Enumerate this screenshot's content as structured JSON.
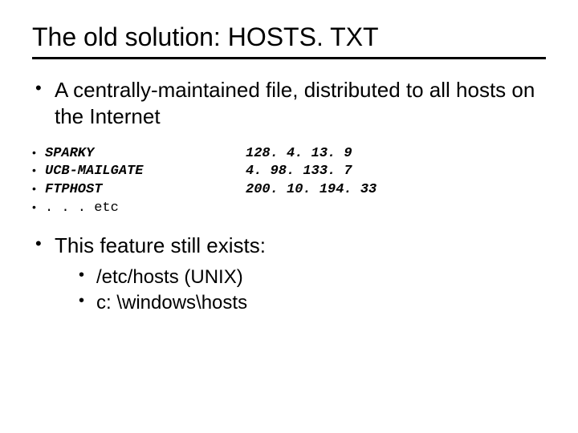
{
  "title": "The old solution: HOSTS. TXT",
  "bullet1": "A centrally-maintained file, distributed to all hosts on the Internet",
  "hosts": [
    {
      "name": "SPARKY",
      "ip": "128. 4. 13. 9"
    },
    {
      "name": "UCB-MAILGATE",
      "ip": "4. 98. 133. 7"
    },
    {
      "name": "FTPHOST",
      "ip": "200. 10. 194. 33"
    }
  ],
  "hosts_etc": ". . . etc",
  "bullet2": "This feature still exists:",
  "sub": [
    "/etc/hosts (UNIX)",
    "c: \\windows\\hosts"
  ]
}
